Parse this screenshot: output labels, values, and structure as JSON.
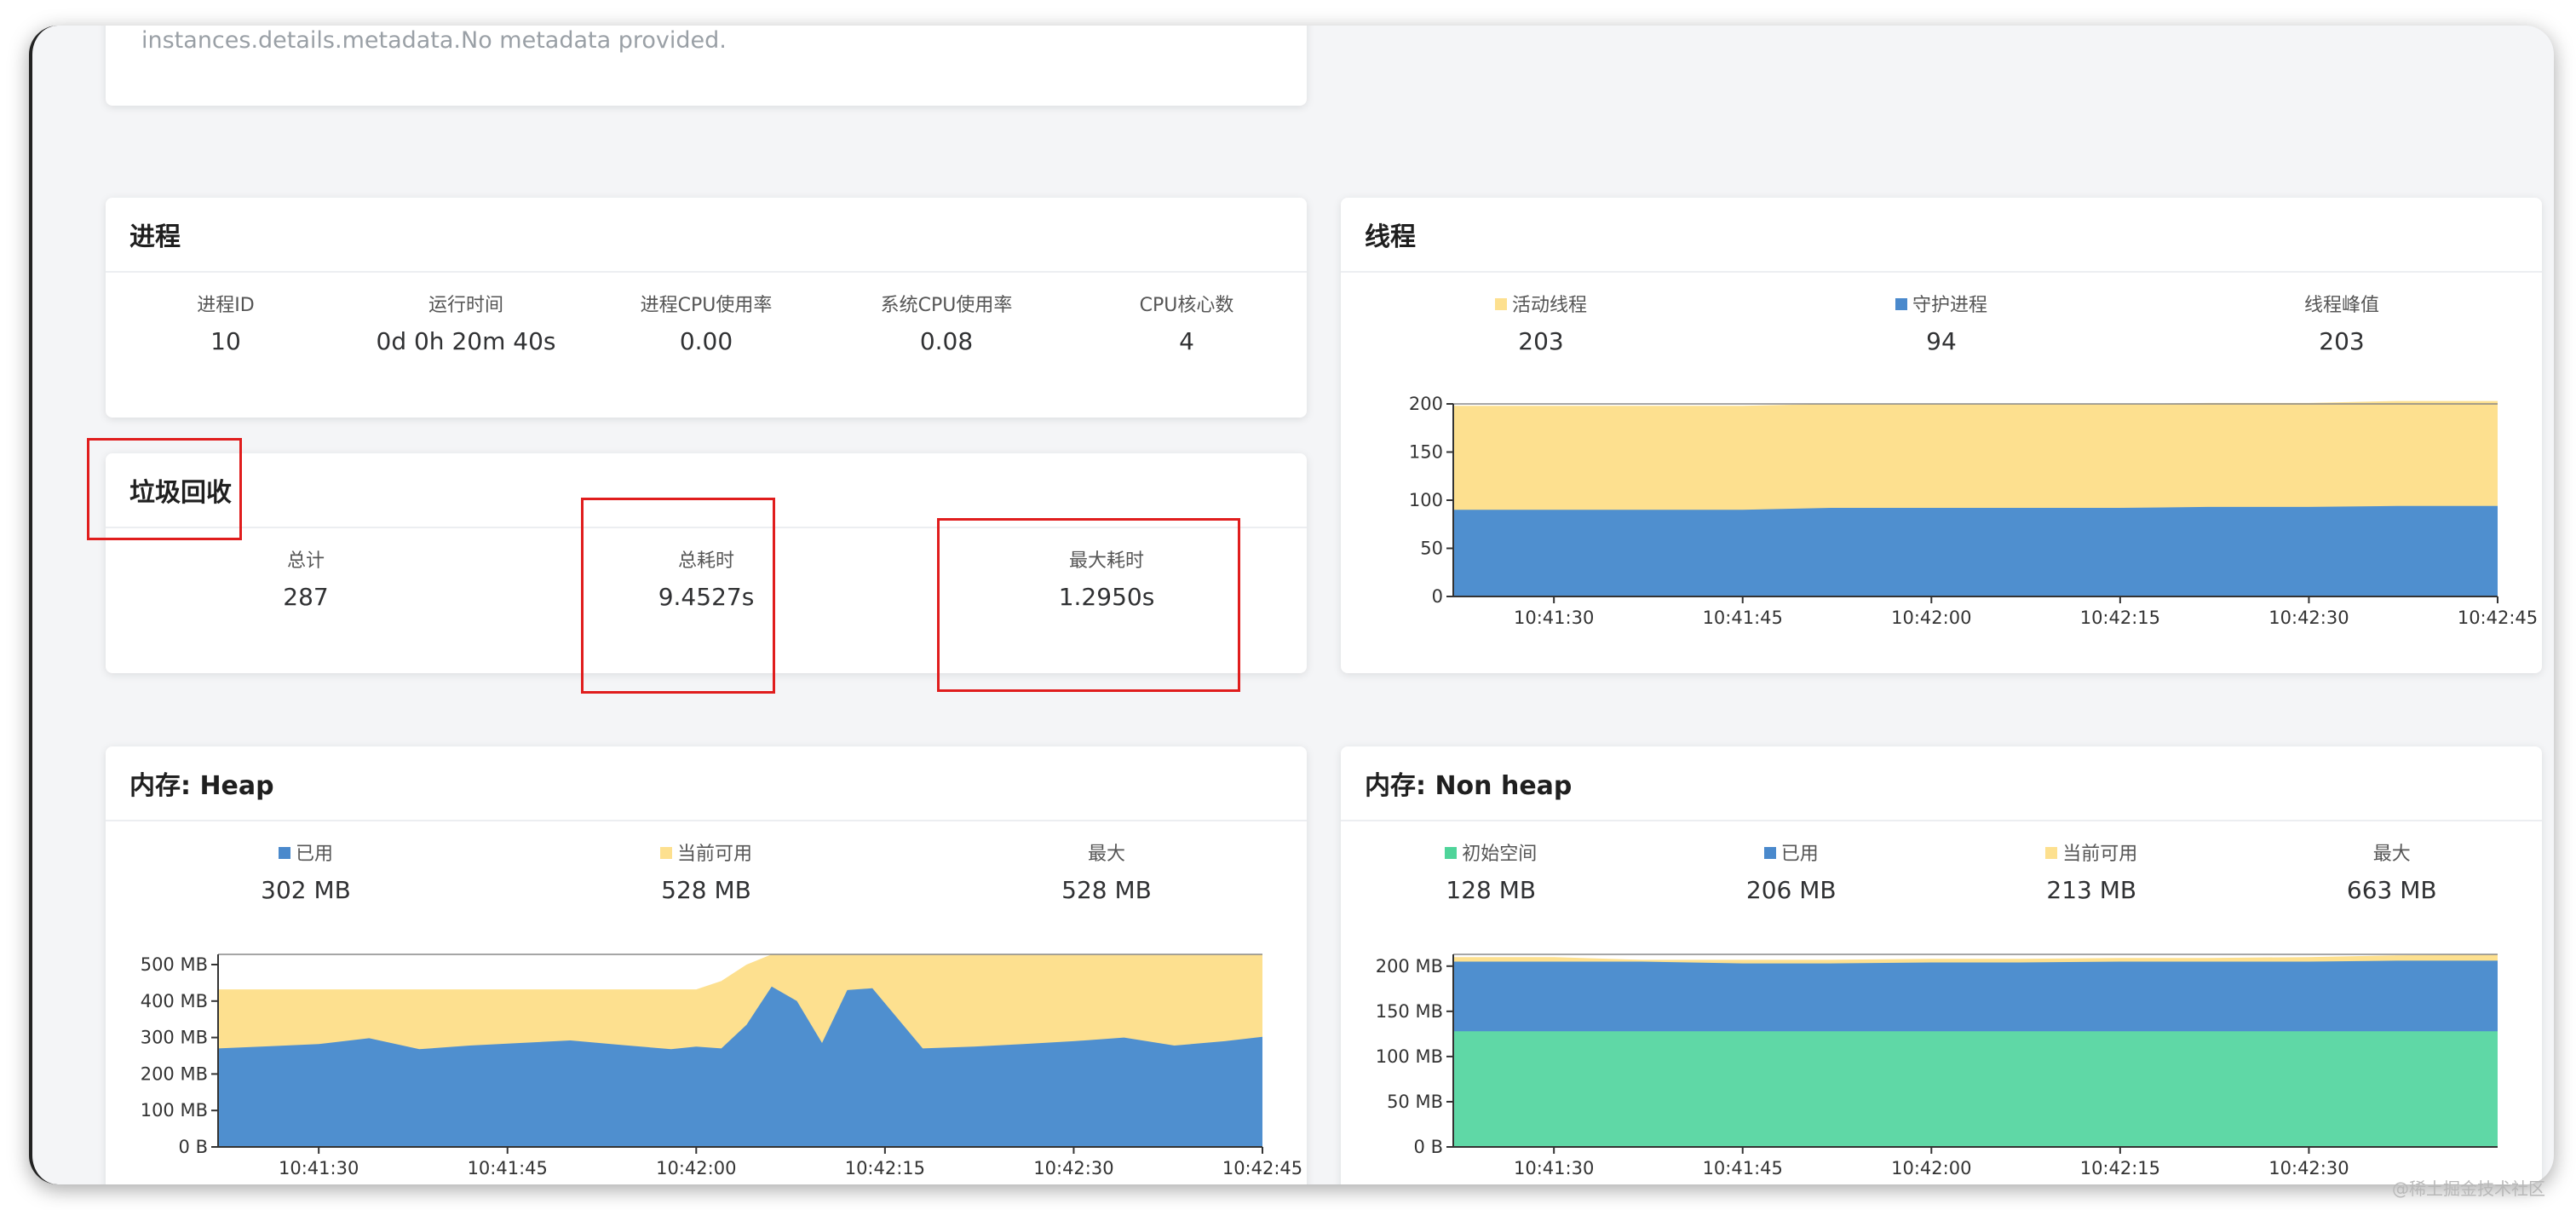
{
  "metadata": {
    "text": "instances.details.metadata.No metadata provided."
  },
  "process": {
    "title": "进程",
    "stats": [
      {
        "label": "进程ID",
        "value": "10"
      },
      {
        "label": "运行时间",
        "value": "0d 0h 20m 40s"
      },
      {
        "label": "进程CPU使用率",
        "value": "0.00"
      },
      {
        "label": "系统CPU使用率",
        "value": "0.08"
      },
      {
        "label": "CPU核心数",
        "value": "4"
      }
    ]
  },
  "gc": {
    "title": "垃圾回收",
    "stats": [
      {
        "label": "总计",
        "value": "287"
      },
      {
        "label": "总耗时",
        "value": "9.4527s"
      },
      {
        "label": "最大耗时",
        "value": "1.2950s"
      }
    ]
  },
  "threads": {
    "title": "线程",
    "stats": [
      {
        "label": "活动线程",
        "value": "203",
        "color": "#fde08f"
      },
      {
        "label": "守护进程",
        "value": "94",
        "color": "#4a89cc"
      },
      {
        "label": "线程峰值",
        "value": "203"
      }
    ]
  },
  "heap": {
    "title": "内存: Heap",
    "stats": [
      {
        "label": "已用",
        "value": "302 MB",
        "color": "#4a89cc"
      },
      {
        "label": "当前可用",
        "value": "528 MB",
        "color": "#fde08f"
      },
      {
        "label": "最大",
        "value": "528 MB"
      }
    ]
  },
  "nonheap": {
    "title": "内存: Non heap",
    "stats": [
      {
        "label": "初始空间",
        "value": "128 MB",
        "color": "#4fd49a"
      },
      {
        "label": "已用",
        "value": "206 MB",
        "color": "#4a89cc"
      },
      {
        "label": "当前可用",
        "value": "213 MB",
        "color": "#fde08f"
      },
      {
        "label": "最大",
        "value": "663 MB"
      }
    ]
  },
  "watermark": "@稀土掘金技术社区",
  "chart_data": [
    {
      "id": "threads",
      "type": "area",
      "x": [
        "10:41:22",
        "10:41:30",
        "10:41:37",
        "10:41:45",
        "10:41:52",
        "10:42:00",
        "10:42:07",
        "10:42:15",
        "10:42:22",
        "10:42:30",
        "10:42:37",
        "10:42:45"
      ],
      "xticks": [
        "10:41:30",
        "10:41:45",
        "10:42:00",
        "10:42:15",
        "10:42:30",
        "10:42:45"
      ],
      "yticks": [
        0,
        50,
        100,
        150,
        200
      ],
      "yticklabels": [
        "0",
        "50",
        "100",
        "150",
        "200"
      ],
      "ylim": [
        0,
        200
      ],
      "series": [
        {
          "name": "守护进程",
          "color": "#4f8fcf",
          "values": [
            90,
            90,
            90,
            90,
            92,
            92,
            92,
            92,
            93,
            93,
            94,
            94
          ]
        },
        {
          "name": "活动线程",
          "color": "#fde08f",
          "values": [
            198,
            198,
            198,
            198,
            200,
            200,
            200,
            200,
            201,
            201,
            203,
            203
          ]
        }
      ]
    },
    {
      "id": "heap",
      "type": "area",
      "x": [
        "10:41:22",
        "10:41:26",
        "10:41:30",
        "10:41:34",
        "10:41:38",
        "10:41:42",
        "10:41:46",
        "10:41:50",
        "10:41:54",
        "10:41:58",
        "10:42:00",
        "10:42:02",
        "10:42:04",
        "10:42:06",
        "10:42:08",
        "10:42:10",
        "10:42:12",
        "10:42:14",
        "10:42:18",
        "10:42:22",
        "10:42:26",
        "10:42:30",
        "10:42:34",
        "10:42:38",
        "10:42:42",
        "10:42:45"
      ],
      "xticks": [
        "10:41:30",
        "10:41:45",
        "10:42:00",
        "10:42:15",
        "10:42:30",
        "10:42:45"
      ],
      "yticks": [
        0,
        100,
        200,
        300,
        400,
        500
      ],
      "yticklabels": [
        "0 B",
        "100 MB",
        "200 MB",
        "300 MB",
        "400 MB",
        "500 MB"
      ],
      "ylim": [
        0,
        528
      ],
      "series": [
        {
          "name": "已用",
          "color": "#4f8fcf",
          "values": [
            270,
            276,
            282,
            298,
            268,
            278,
            285,
            292,
            280,
            268,
            275,
            270,
            335,
            440,
            400,
            285,
            430,
            435,
            270,
            275,
            282,
            290,
            300,
            278,
            290,
            302
          ]
        },
        {
          "name": "当前可用",
          "color": "#fde08f",
          "values": [
            432,
            432,
            432,
            432,
            432,
            432,
            432,
            432,
            432,
            432,
            432,
            455,
            500,
            528,
            528,
            528,
            528,
            528,
            528,
            528,
            528,
            528,
            528,
            528,
            528,
            528
          ]
        }
      ]
    },
    {
      "id": "nonheap",
      "type": "area",
      "x": [
        "10:41:22",
        "10:41:30",
        "10:41:37",
        "10:41:45",
        "10:41:52",
        "10:42:00",
        "10:42:07",
        "10:42:15",
        "10:42:22",
        "10:42:30",
        "10:42:37",
        "10:42:45"
      ],
      "xticks": [
        "10:41:30",
        "10:41:45",
        "10:42:00",
        "10:42:15",
        "10:42:30"
      ],
      "yticks": [
        0,
        50,
        100,
        150,
        200
      ],
      "yticklabels": [
        "0 B",
        "50 MB",
        "100 MB",
        "150 MB",
        "200 MB"
      ],
      "ylim": [
        0,
        213
      ],
      "series": [
        {
          "name": "初始空间",
          "color": "#5fd8a6",
          "values": [
            128,
            128,
            128,
            128,
            128,
            128,
            128,
            128,
            128,
            128,
            128,
            128
          ]
        },
        {
          "name": "已用",
          "color": "#4f8fcf",
          "values": [
            205,
            205,
            205,
            203,
            203,
            204,
            204,
            205,
            205,
            205,
            206,
            206
          ]
        },
        {
          "name": "当前可用",
          "color": "#fde08f",
          "values": [
            210,
            210,
            207,
            207,
            207,
            208,
            208,
            209,
            209,
            210,
            212,
            213
          ]
        }
      ]
    }
  ]
}
